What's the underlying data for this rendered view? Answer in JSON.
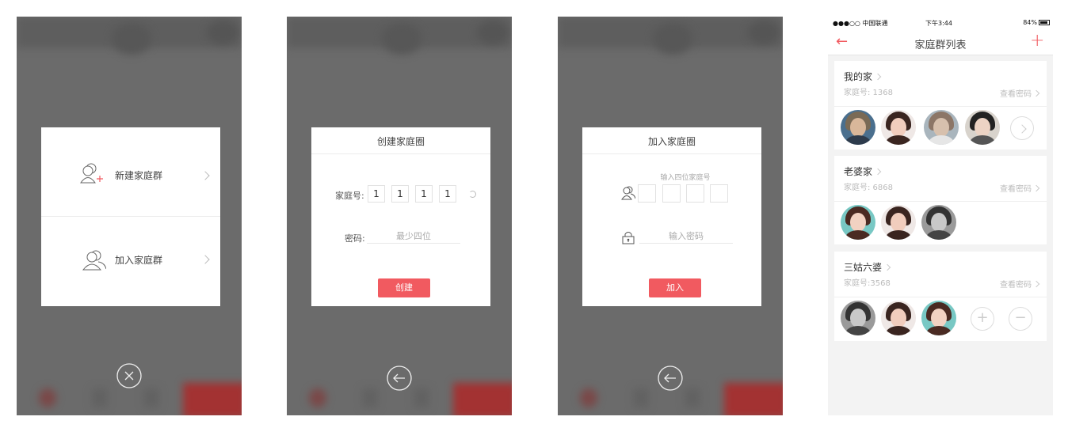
{
  "panel1": {
    "options": [
      {
        "label": "新建家庭群",
        "icon": "add-user-icon"
      },
      {
        "label": "加入家庭群",
        "icon": "users-icon"
      }
    ],
    "close_icon": "close-circle-icon"
  },
  "panel2": {
    "title": "创建家庭圈",
    "number_label": "家庭号:",
    "digits": [
      "1",
      "1",
      "1",
      "1"
    ],
    "password_label": "密码:",
    "password_placeholder": "最少四位",
    "submit": "创建",
    "back_icon": "back-circle-icon"
  },
  "panel3": {
    "title": "加入家庭圈",
    "hint": "输入四位家庭号",
    "password_placeholder": "输入密码",
    "submit": "加入",
    "back_icon": "back-circle-icon"
  },
  "panel4": {
    "status": {
      "carrier": "●●●○○ 中国联通",
      "time": "下午3:44",
      "battery": "84%"
    },
    "nav_title": "家庭群列表",
    "families": [
      {
        "name": "我的家",
        "number": "家庭号: 1368",
        "password_link": "查看密码"
      },
      {
        "name": "老婆家",
        "number": "家庭号: 6868",
        "password_link": "查看密码"
      },
      {
        "name": "三姑六婆",
        "number": "家庭号:3568",
        "password_link": "查看密码"
      }
    ]
  },
  "colors": {
    "accent": "#f15a60",
    "overlay": "#6b6b6b"
  }
}
